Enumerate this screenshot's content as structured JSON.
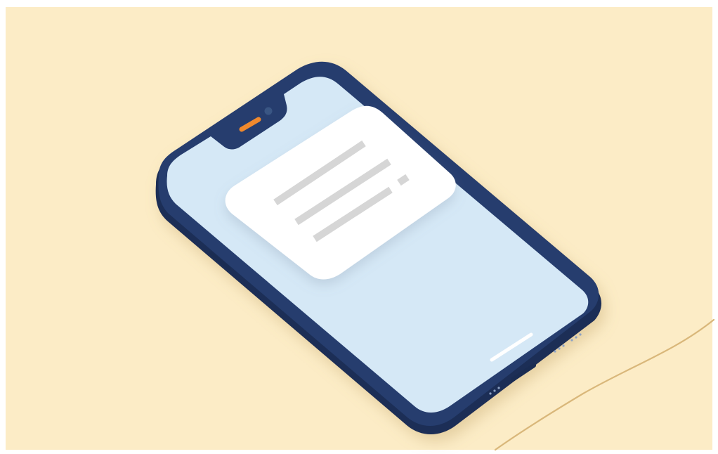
{
  "scene": {
    "background_color": "#fcecc6",
    "frame_color": "#ffffff",
    "cable_color": "#d9b77a"
  },
  "phone": {
    "body_color": "#253d6e",
    "body_edge_color": "#1c2f57",
    "screen_color": "#d5e8f6",
    "earpiece_color": "#f0892d",
    "camera_color": "#3a5684",
    "home_indicator_color": "#ffffff"
  },
  "notification_card": {
    "card_color": "#ffffff",
    "text_line_color": "#d6d6d6",
    "text_line_count": 3,
    "icons": [
      "notification-text-icon"
    ]
  }
}
